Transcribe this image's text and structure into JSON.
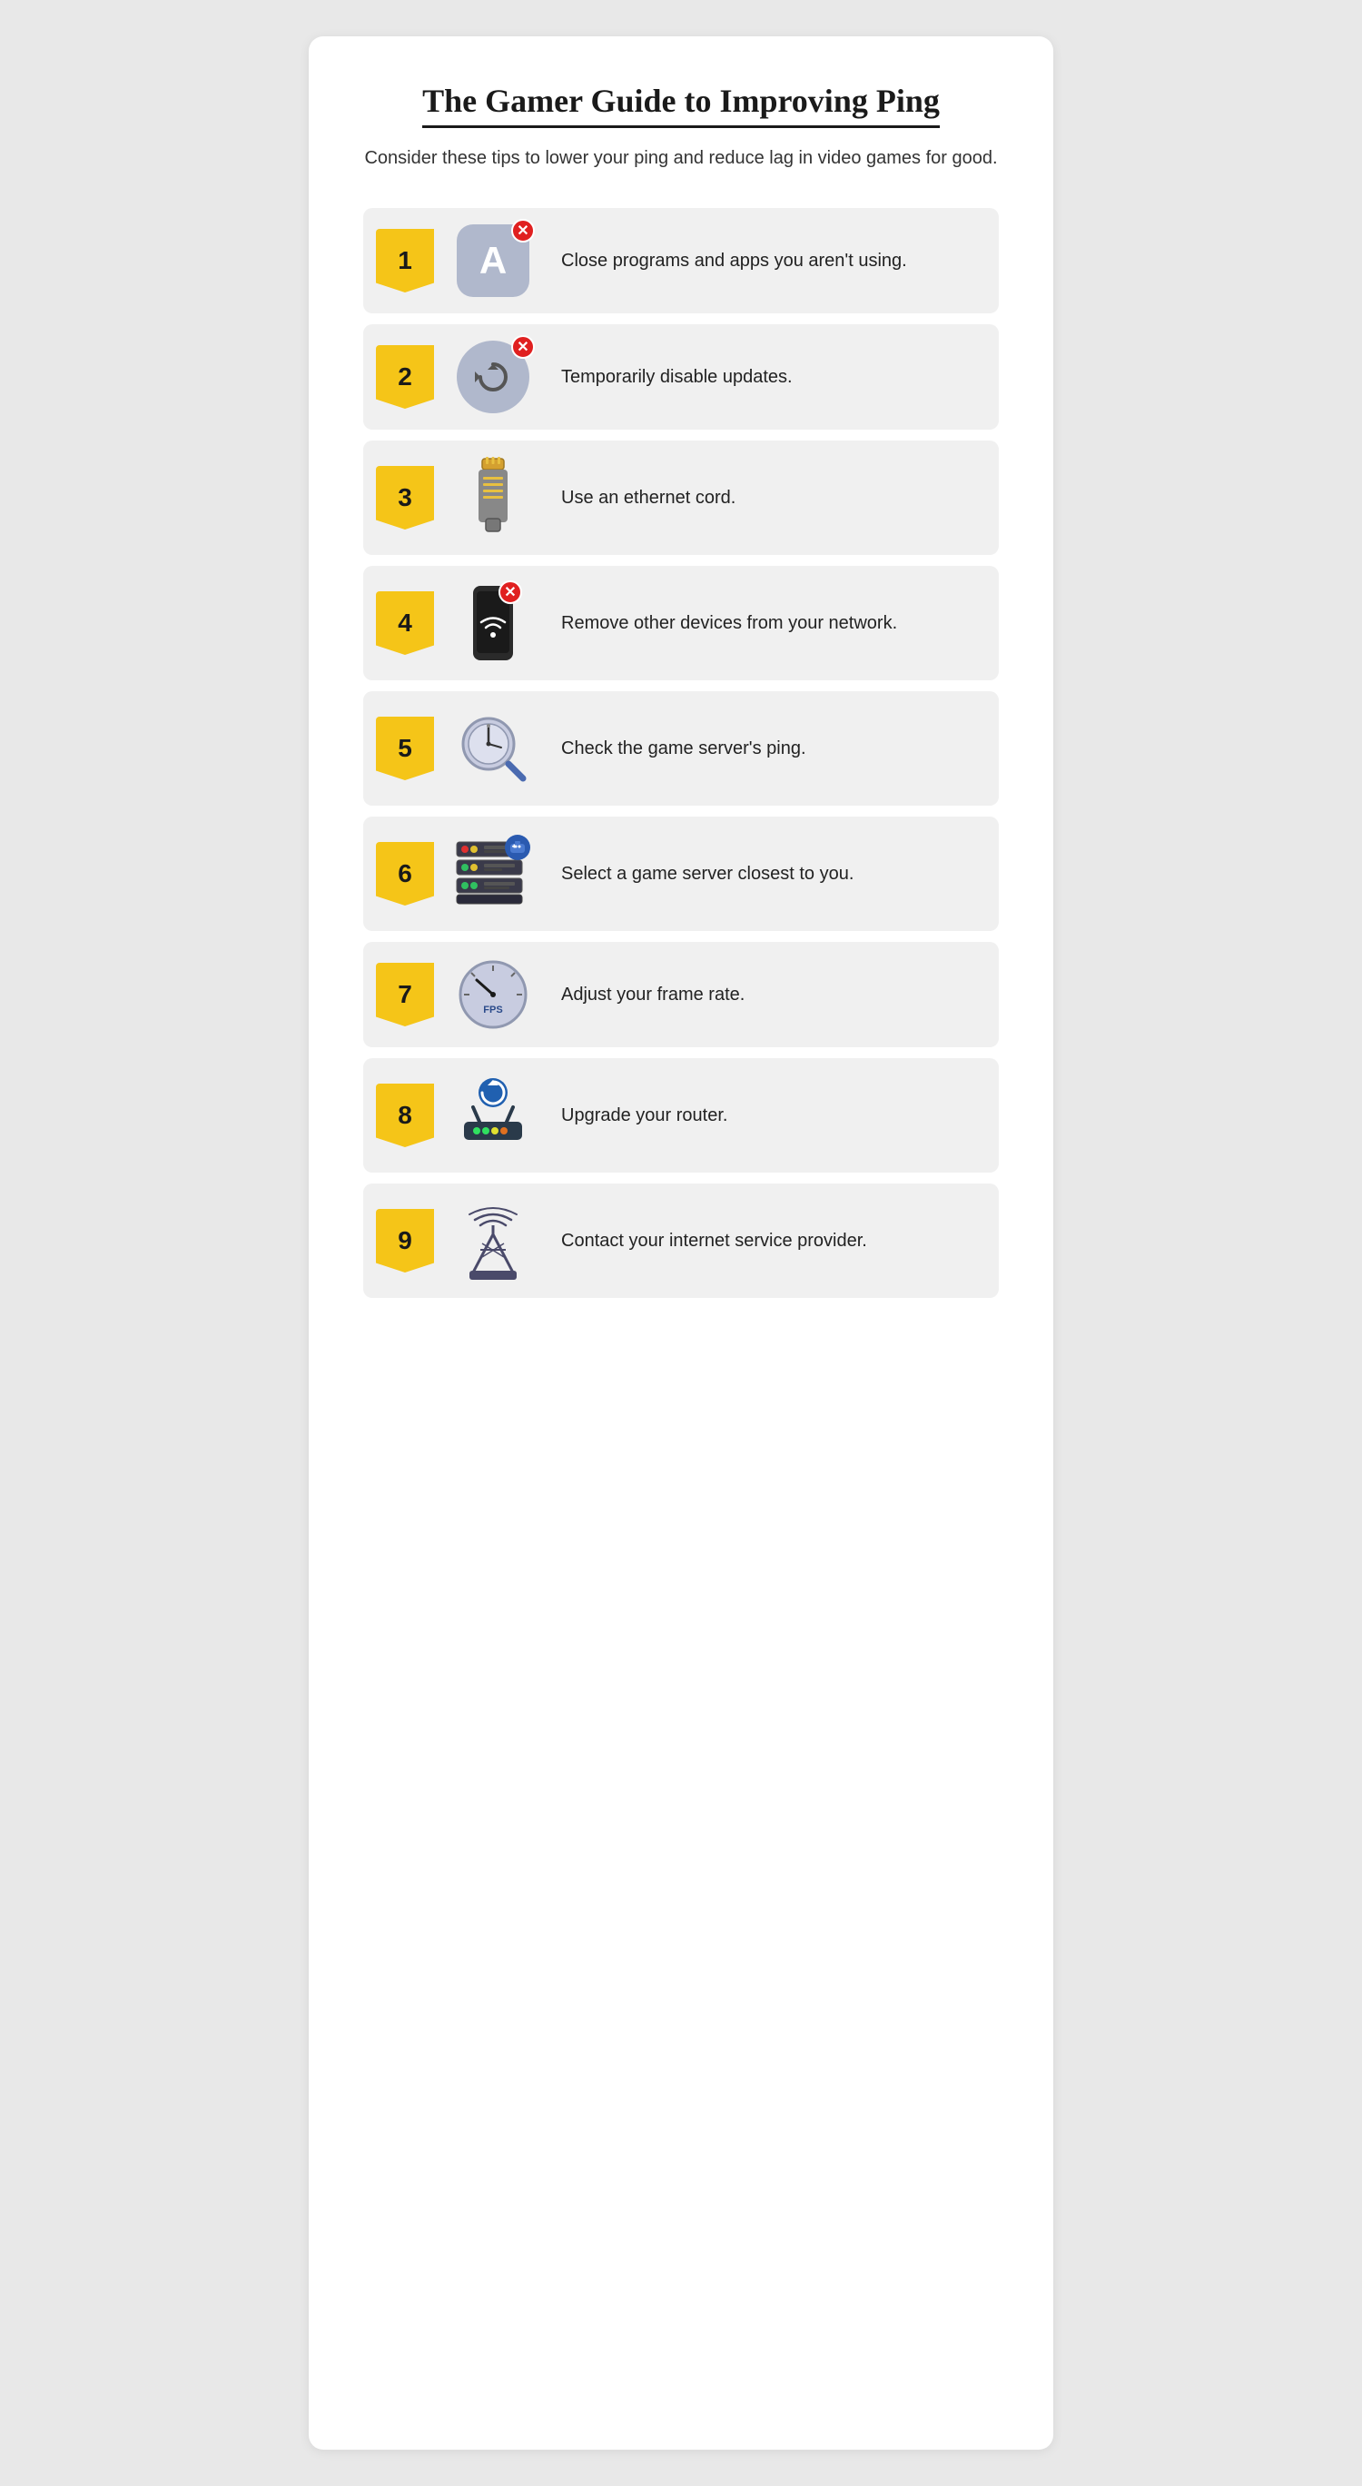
{
  "header": {
    "title": "The Gamer Guide to Improving Ping",
    "subtitle": "Consider these tips to lower your ping and reduce lag in video games for good."
  },
  "items": [
    {
      "number": "1",
      "text": "Close programs and apps you aren't using.",
      "icon": "app-close"
    },
    {
      "number": "2",
      "text": "Temporarily disable updates.",
      "icon": "update-disable"
    },
    {
      "number": "3",
      "text": "Use an ethernet cord.",
      "icon": "ethernet"
    },
    {
      "number": "4",
      "text": "Remove other devices from your network.",
      "icon": "phone-wifi"
    },
    {
      "number": "5",
      "text": "Check the game server's ping.",
      "icon": "clock-magnifier"
    },
    {
      "number": "6",
      "text": "Select a game server closest to you.",
      "icon": "game-server"
    },
    {
      "number": "7",
      "text": "Adjust your frame rate.",
      "icon": "fps-meter"
    },
    {
      "number": "8",
      "text": "Upgrade your router.",
      "icon": "router"
    },
    {
      "number": "9",
      "text": "Contact your internet service provider.",
      "icon": "tower"
    }
  ],
  "colors": {
    "badge_yellow": "#f5c518",
    "red_x": "#e02020",
    "background": "#e8e8e8",
    "card": "#ffffff",
    "row_bg": "#f0f0f0"
  }
}
